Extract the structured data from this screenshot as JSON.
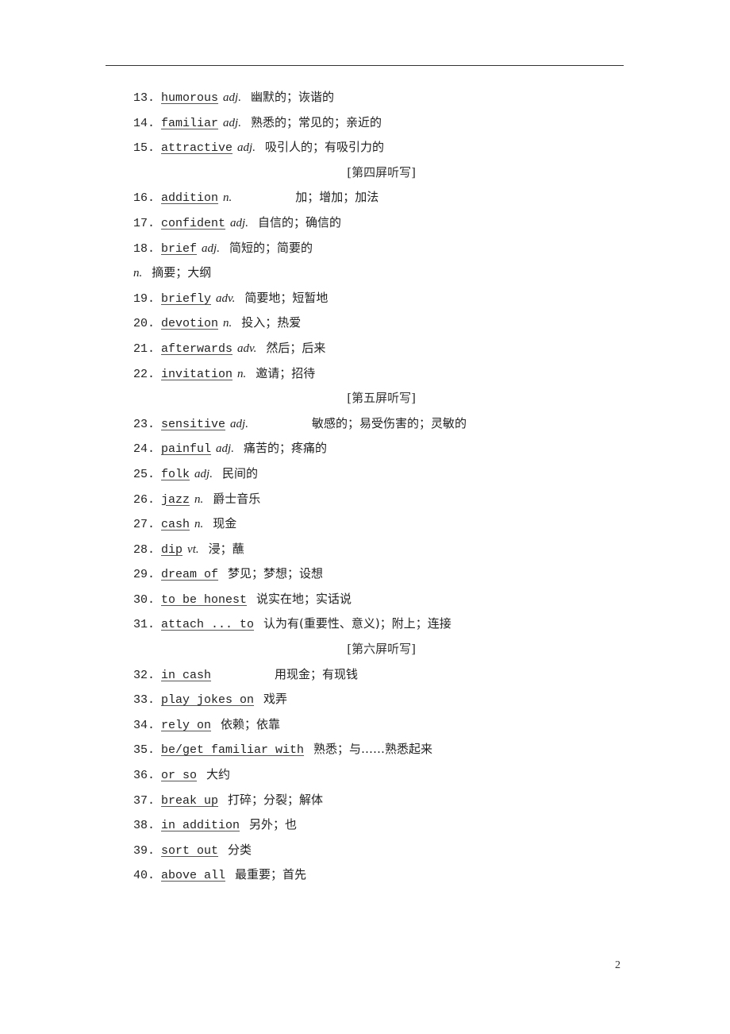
{
  "entries": [
    {
      "type": "item",
      "num": "13.",
      "term": "humorous",
      "pos": "adj.",
      "meaning": "幽默的；诙谐的"
    },
    {
      "type": "item",
      "num": "14.",
      "term": "familiar",
      "pos": "adj.",
      "meaning": "熟悉的；常见的；亲近的"
    },
    {
      "type": "item",
      "num": "15.",
      "term": "attractive",
      "pos": "adj.",
      "meaning": "吸引人的；有吸引力的"
    },
    {
      "type": "section",
      "label": "[第四屏听写]"
    },
    {
      "type": "item",
      "num": "16.",
      "term": "addition",
      "pos": "n.",
      "meaning": "加；增加；加法",
      "gap": true
    },
    {
      "type": "item",
      "num": "17.",
      "term": "confident",
      "pos": "adj.",
      "meaning": "自信的；确信的"
    },
    {
      "type": "item",
      "num": "18.",
      "term": "brief",
      "pos": "adj.",
      "meaning": "简短的；简要的"
    },
    {
      "type": "cont",
      "pos": "n.",
      "meaning": "摘要；大纲"
    },
    {
      "type": "item",
      "num": "19.",
      "term": "briefly",
      "pos": "adv.",
      "meaning": "简要地；短暂地"
    },
    {
      "type": "item",
      "num": "20.",
      "term": "devotion",
      "pos": "n.",
      "meaning": "投入；热爱"
    },
    {
      "type": "item",
      "num": "21.",
      "term": "afterwards",
      "pos": "adv.",
      "meaning": "然后；后来"
    },
    {
      "type": "item",
      "num": "22.",
      "term": "invitation",
      "pos": "n.",
      "meaning": "邀请；招待"
    },
    {
      "type": "section",
      "label": "[第五屏听写]"
    },
    {
      "type": "item",
      "num": "23.",
      "term": "sensitive",
      "pos": "adj.",
      "meaning": "敏感的；易受伤害的；灵敏的",
      "gap": true
    },
    {
      "type": "item",
      "num": "24.",
      "term": "painful",
      "pos": "adj.",
      "meaning": "痛苦的；疼痛的"
    },
    {
      "type": "item",
      "num": "25.",
      "term": "folk",
      "pos": "adj.",
      "meaning": "民间的"
    },
    {
      "type": "item",
      "num": "26.",
      "term": "jazz",
      "pos": "n.",
      "meaning": "爵士音乐"
    },
    {
      "type": "item",
      "num": "27.",
      "term": "cash",
      "pos": "n.",
      "meaning": "现金"
    },
    {
      "type": "item",
      "num": "28.",
      "term": "dip",
      "pos": "vt.",
      "meaning": "浸；蘸"
    },
    {
      "type": "item",
      "num": "29.",
      "term": "dream of",
      "pos": "",
      "meaning": "梦见；梦想；设想"
    },
    {
      "type": "item",
      "num": "30.",
      "term": "to be honest",
      "pos": "",
      "meaning": "说实在地；实话说"
    },
    {
      "type": "item",
      "num": "31.",
      "term": "attach ... to",
      "pos": "",
      "meaning": "认为有(重要性、意义)；附上；连接"
    },
    {
      "type": "section",
      "label": "[第六屏听写]"
    },
    {
      "type": "item",
      "num": "32.",
      "term": "in cash",
      "pos": "",
      "meaning": "用现金；有现钱",
      "gap": true
    },
    {
      "type": "item",
      "num": "33.",
      "term": "play jokes on",
      "pos": "",
      "meaning": "戏弄"
    },
    {
      "type": "item",
      "num": "34.",
      "term": "rely on",
      "pos": "",
      "meaning": "依赖；依靠"
    },
    {
      "type": "item",
      "num": "35.",
      "term": "be/get familiar with",
      "pos": "",
      "meaning": "熟悉；与……熟悉起来"
    },
    {
      "type": "item",
      "num": "36.",
      "term": "or so",
      "pos": "",
      "meaning": "大约"
    },
    {
      "type": "item",
      "num": "37.",
      "term": "break up",
      "pos": "",
      "meaning": "打碎；分裂；解体"
    },
    {
      "type": "item",
      "num": "38.",
      "term": "in addition",
      "pos": "",
      "meaning": "另外；也"
    },
    {
      "type": "item",
      "num": "39.",
      "term": "sort out",
      "pos": "",
      "meaning": "分类"
    },
    {
      "type": "item",
      "num": "40.",
      "term": "above all",
      "pos": "",
      "meaning": "最重要；首先"
    }
  ],
  "footer": {
    "page_number": "2"
  }
}
